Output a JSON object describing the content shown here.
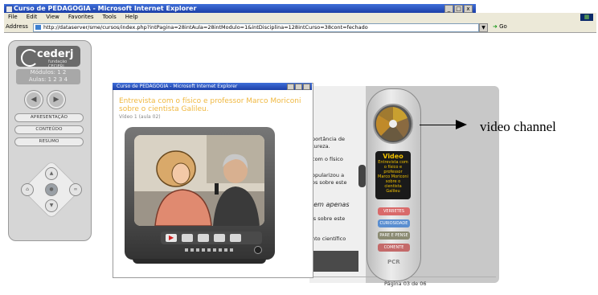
{
  "window": {
    "title": "Curso de PEDAGOGIA - Microsoft Internet Explorer",
    "controls": [
      "_",
      "□",
      "x"
    ]
  },
  "menu": [
    "File",
    "Edit",
    "View",
    "Favorites",
    "Tools",
    "Help"
  ],
  "address": {
    "label": "Address",
    "url": "http://dataserver/sme/cursos/index.php?intPagina=28intAula=28intModulo=1&intDisciplina=128intCurso=38cont=fechado",
    "go": "Go"
  },
  "left_panel": {
    "logo": "cederj",
    "logo_sub": "fundação CECIERJ",
    "modulos": "Módulos: 1 2",
    "aulas": "Aulas: 1 2 3 4",
    "buttons": [
      "APRESENTAÇÃO",
      "CONTEÚDO",
      "RESUMO"
    ]
  },
  "background_text": {
    "line1": "portância de",
    "line2": "tureza.",
    "line3": "com o físico",
    "line4": "opularizou a",
    "line5": "os sobre este",
    "line6": "'em apenas",
    "line7": "is sobre este",
    "line8": "nto científico",
    "pagina": "Página 03 de 06"
  },
  "popup": {
    "title": "Curso de PEDAGOGIA - Microsoft Internet Explorer",
    "heading": "Entrevista com o físico e professor Marco Moriconi sobre o cientista Galileu.",
    "sub": "Vídeo 1 (aula 02)"
  },
  "remote": {
    "display_title": "Video",
    "display_text": "Entrevista com o físico e professor Marco Moriconi sobre o cientista Galileu",
    "buttons": [
      {
        "label": "VERBETES",
        "color": "#d96a6a"
      },
      {
        "label": "CURIOSIDADE",
        "color": "#5a8ed0"
      },
      {
        "label": "PARE E PENSE",
        "color": "#8a8a72"
      },
      {
        "label": "COMENTE",
        "color": "#c46a6a"
      }
    ],
    "footer": "PCR"
  },
  "annotation": "video channel",
  "colors": {
    "titlebar": "#1c3fa8",
    "heading": "#f0b840",
    "remote_display_text": "#f0c000"
  }
}
